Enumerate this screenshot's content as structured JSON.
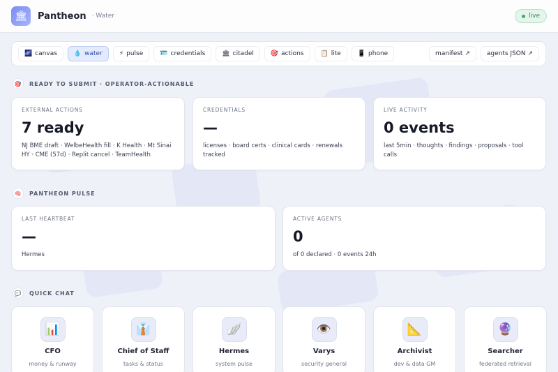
{
  "header": {
    "logo_glyph": "🏛",
    "title": "Pantheon",
    "subtitle": "· Water",
    "status": "live",
    "status_color": "#3fae6b"
  },
  "nav": {
    "items": [
      {
        "icon": "🌌",
        "label": "canvas",
        "active": false
      },
      {
        "icon": "💧",
        "label": "water",
        "active": true
      },
      {
        "icon": "⚡",
        "label": "pulse",
        "active": false
      },
      {
        "icon": "🪪",
        "label": "credentials",
        "active": false
      },
      {
        "icon": "🏛",
        "label": "citadel",
        "active": false
      },
      {
        "icon": "🎯",
        "label": "actions",
        "active": false
      },
      {
        "icon": "📋",
        "label": "lite",
        "active": false
      },
      {
        "icon": "📱",
        "label": "phone",
        "active": false
      }
    ],
    "links": [
      {
        "label": "manifest ↗"
      },
      {
        "label": "agents JSON ↗"
      }
    ]
  },
  "sections": {
    "ready": {
      "icon": "🎯",
      "title": "READY TO SUBMIT · OPERATOR-ACTIONABLE"
    },
    "pulse": {
      "icon": "🧠",
      "title": "PANTHEON PULSE"
    },
    "chat": {
      "icon": "💬",
      "title": "QUICK CHAT"
    }
  },
  "ready_cards": [
    {
      "label": "EXTERNAL ACTIONS",
      "value": "7 ready",
      "desc": "NJ BME draft · WelbeHealth fill · K Health · Mt Sinai HY · CME (57d) · Replit cancel · TeamHealth"
    },
    {
      "label": "CREDENTIALS",
      "value": "—",
      "desc": "licenses · board certs · clinical cards · renewals tracked"
    },
    {
      "label": "LIVE ACTIVITY",
      "value": "0 events",
      "desc": "last 5min · thoughts · findings · proposals · tool calls"
    }
  ],
  "pulse_cards": [
    {
      "label": "LAST HEARTBEAT",
      "value": "—",
      "desc": "Hermes"
    },
    {
      "label": "ACTIVE AGENTS",
      "value": "0",
      "desc": "of 0 declared · 0 events 24h"
    }
  ],
  "agents": [
    {
      "icon": "📊",
      "name": "CFO",
      "sub": "money & runway"
    },
    {
      "icon": "👔",
      "name": "Chief of Staff",
      "sub": "tasks & status"
    },
    {
      "icon": "🪽",
      "name": "Hermes",
      "sub": "system pulse"
    },
    {
      "icon": "👁️",
      "name": "Varys",
      "sub": "security general"
    },
    {
      "icon": "📐",
      "name": "Archivist",
      "sub": "dev & data GM"
    },
    {
      "icon": "🔮",
      "name": "Searcher",
      "sub": "federated retrieval"
    }
  ]
}
